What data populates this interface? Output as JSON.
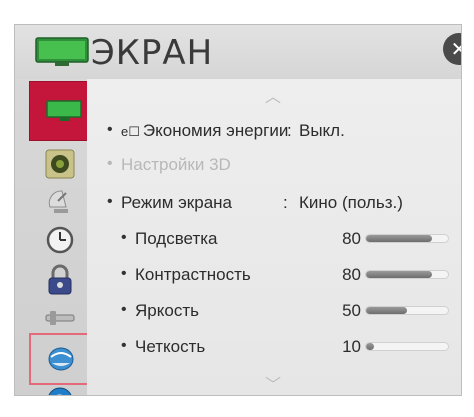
{
  "header": {
    "title": "ЭКРАН",
    "close_glyph": "✕"
  },
  "sidebar": {
    "items": [
      {
        "name": "sidebar-item-screen",
        "icon": "tv-icon",
        "active": true
      },
      {
        "name": "sidebar-item-sound",
        "icon": "speaker-icon"
      },
      {
        "name": "sidebar-item-channels",
        "icon": "satellite-dish-icon"
      },
      {
        "name": "sidebar-item-time",
        "icon": "clock-icon"
      },
      {
        "name": "sidebar-item-lock",
        "icon": "padlock-icon"
      },
      {
        "name": "sidebar-item-options",
        "icon": "tools-icon"
      },
      {
        "name": "sidebar-item-network",
        "icon": "network-globe-icon",
        "outlined": true
      },
      {
        "name": "sidebar-item-support",
        "icon": "help-icon",
        "glyph": "?"
      }
    ]
  },
  "menu": {
    "scroll_up_glyph": "︿",
    "scroll_down_glyph": "﹀",
    "bullet": "•",
    "energy_saving": {
      "eco_glyph": "e☐",
      "label": "Экономия энергии",
      "colon": ":",
      "value": "Выкл."
    },
    "settings_3d": {
      "label": "Настройки 3D"
    },
    "picture_mode": {
      "label": "Режим экрана",
      "colon": ":",
      "value": "Кино (польз.)"
    },
    "backlight": {
      "label": "Подсветка",
      "value": "80",
      "level": 80
    },
    "contrast": {
      "label": "Контрастность",
      "value": "80",
      "level": 80
    },
    "brightness": {
      "label": "Яркость",
      "value": "50",
      "level": 50
    },
    "sharpness": {
      "label": "Четкость",
      "value": "10",
      "level": 10
    }
  },
  "colors": {
    "accent": "#c4153a",
    "highlight_outline": "#e46a7a",
    "tv_green": "#3bb84a"
  }
}
